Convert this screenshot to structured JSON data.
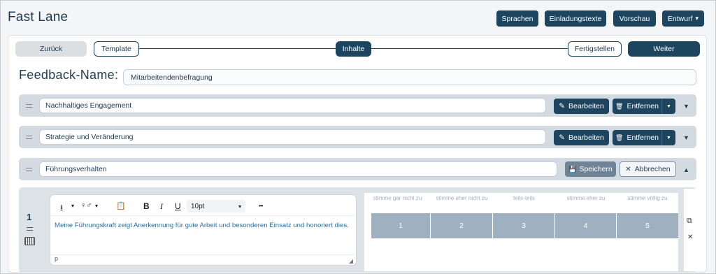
{
  "app": {
    "title": "Fast Lane"
  },
  "top_buttons": {
    "sprachen": "Sprachen",
    "einladungstexte": "Einladungstexte",
    "vorschau": "Vorschau",
    "entwurf": "Entwurf"
  },
  "steps": {
    "back": "Zurück",
    "template": "Template",
    "inhalte": "Inhalte",
    "fertigstellen": "Fertigstellen",
    "weiter": "Weiter"
  },
  "feedback": {
    "label": "Feedback-Name:",
    "value": "Mitarbeitendenbefragung"
  },
  "sections": [
    {
      "title": "Nachhaltiges Engagement",
      "edit": "Bearbeiten",
      "remove": "Entfernen"
    },
    {
      "title": "Strategie und Veränderung",
      "edit": "Bearbeiten",
      "remove": "Entfernen"
    },
    {
      "title": "Führungsverhalten",
      "save": "Speichern",
      "cancel": "Abbrechen"
    }
  ],
  "question": {
    "number": "1",
    "editor": {
      "font_size": "10pt",
      "text": "Meine Führungskraft zeigt Anerkennung für gute Arbeit und besonderen Einsatz und honoriert dies.",
      "status": "p"
    },
    "scale_headers": [
      "stimme gar nicht zu",
      "stimme eher nicht zu",
      "teils-teils",
      "stimme eher zu",
      "stimme völlig zu"
    ],
    "scale_values": [
      "1",
      "2",
      "3",
      "4",
      "5"
    ]
  },
  "icons": {
    "arrow_down": "▼",
    "arrow_up": "▲",
    "caret": "▾",
    "pencil": "✎",
    "trash": "🗑",
    "save": "💾",
    "close": "✕",
    "import": "⭳",
    "gender": "♀♂",
    "clipboard": "📋",
    "bold": "B",
    "italic": "I",
    "underline": "U",
    "more": "•••",
    "copy": "⧉"
  },
  "colors": {
    "primary": "#1d4560",
    "section_bg": "#d4dae1",
    "scale_cell": "#9fb1c0",
    "editor_text": "#2d6ea0"
  }
}
